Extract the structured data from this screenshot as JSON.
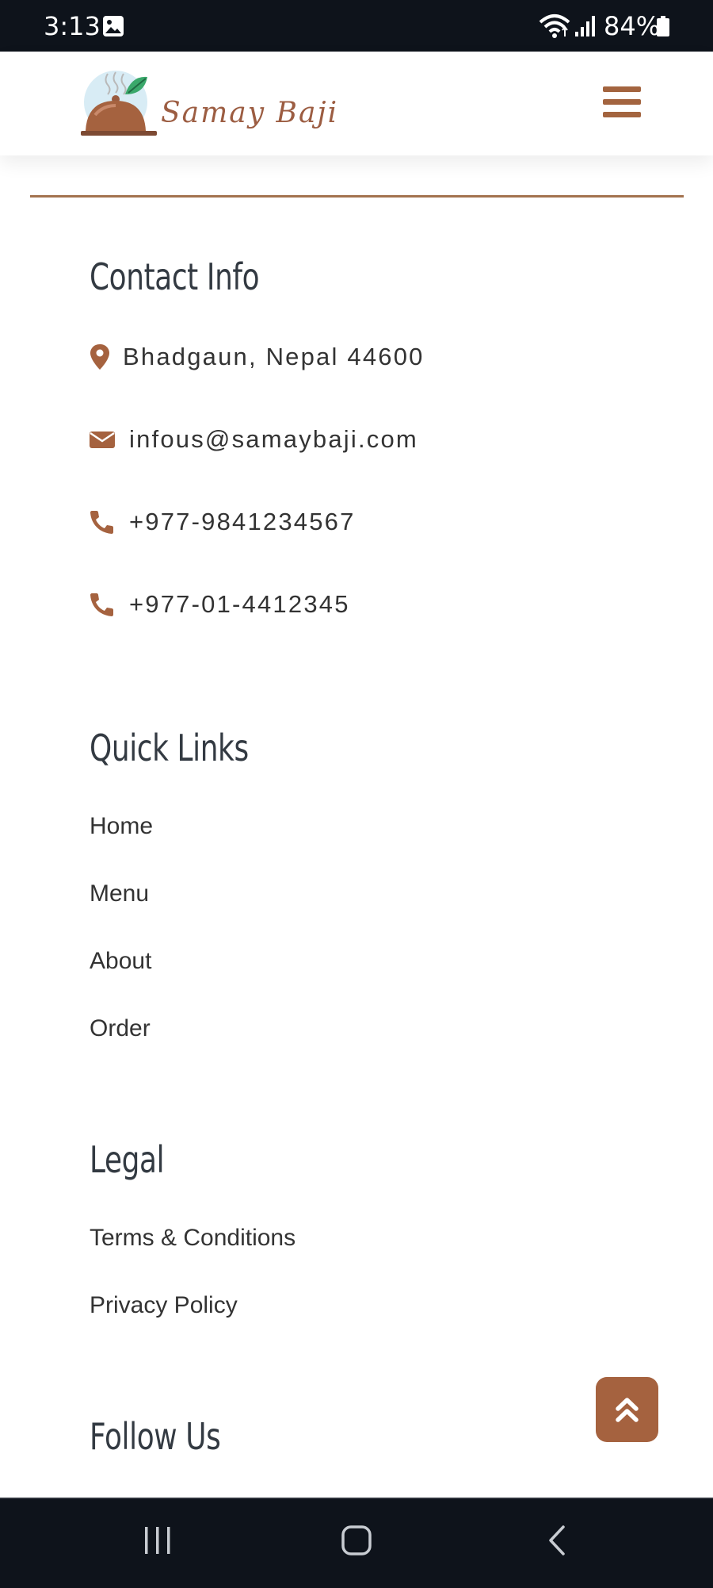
{
  "status_bar": {
    "time": "3:13",
    "battery": "84%",
    "icons": [
      "gallery-icon",
      "wifi-icon",
      "signal-icon",
      "battery-icon"
    ]
  },
  "header": {
    "brand": "Samay Baji",
    "logo_icon": "food-cloche-icon",
    "menu_icon": "hamburger-menu-icon"
  },
  "colors": {
    "accent": "#a5623f",
    "brand": "#9c5d42",
    "heading": "#333a42",
    "text": "#333333",
    "system_bar": "#0e131b"
  },
  "contact": {
    "title": "Contact Info",
    "items": [
      {
        "icon": "map-marker-icon",
        "text": "Bhadgaun, Nepal 44600"
      },
      {
        "icon": "envelope-icon",
        "text": "infous@samaybaji.com"
      },
      {
        "icon": "phone-icon",
        "text": "+977-9841234567"
      },
      {
        "icon": "phone-icon",
        "text": "+977-01-4412345"
      }
    ]
  },
  "quick_links": {
    "title": "Quick Links",
    "items": [
      "Home",
      "Menu",
      "About",
      "Order"
    ]
  },
  "legal": {
    "title": "Legal",
    "items": [
      "Terms & Conditions",
      "Privacy Policy"
    ]
  },
  "follow": {
    "title": "Follow Us"
  },
  "scroll_top": {
    "icon": "double-chevron-up-icon"
  },
  "nav_bar": {
    "buttons": [
      "recent-apps-icon",
      "home-icon",
      "back-icon"
    ]
  }
}
